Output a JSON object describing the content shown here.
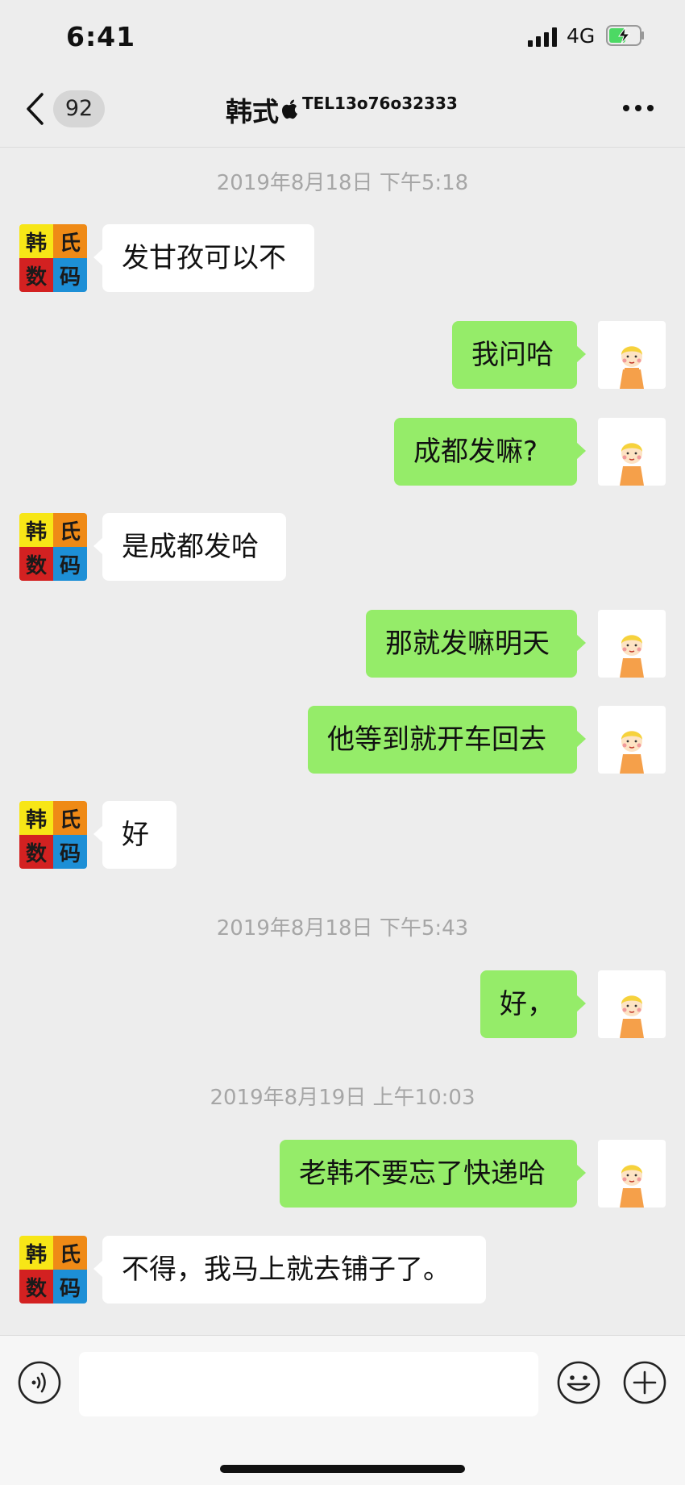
{
  "status_bar": {
    "time": "6:41",
    "network": "4G",
    "battery": "charging"
  },
  "nav": {
    "unread_count": "92",
    "title_name": "韩式",
    "title_suffix": "TEL13o76o32333",
    "title_icon": "apple-icon",
    "more_icon": "ellipsis-icon"
  },
  "timestamps": [
    "2019年8月18日 下午5:18",
    "2019年8月18日 下午5:43",
    "2019年8月19日 上午10:03"
  ],
  "contact_logo": {
    "chars": [
      "韩",
      "氏",
      "数",
      "码"
    ],
    "colors": [
      "#f7e617",
      "#ef8a16",
      "#d32121",
      "#1d8fd6"
    ]
  },
  "messages": [
    {
      "side": "in",
      "text": "发甘孜可以不"
    },
    {
      "side": "out",
      "text": "我问哈"
    },
    {
      "side": "out",
      "text": "成都发嘛?"
    },
    {
      "side": "in",
      "text": "是成都发哈"
    },
    {
      "side": "out",
      "text": "那就发嘛明天"
    },
    {
      "side": "out",
      "text": "他等到就开车回去"
    },
    {
      "side": "in",
      "text": "好"
    },
    {
      "side": "out",
      "text": "好，"
    },
    {
      "side": "out",
      "text": "老韩不要忘了快递哈"
    },
    {
      "side": "in",
      "text": "不得，我马上就去铺子了。"
    }
  ],
  "input_bar": {
    "text_value": "",
    "voice_icon": "voice-icon",
    "emoji_icon": "emoji-icon",
    "plus_icon": "plus-icon"
  },
  "colors": {
    "background": "#ededed",
    "outgoing_bubble": "#95ec69",
    "incoming_bubble": "#ffffff",
    "timestamp": "#a6a6a6"
  }
}
